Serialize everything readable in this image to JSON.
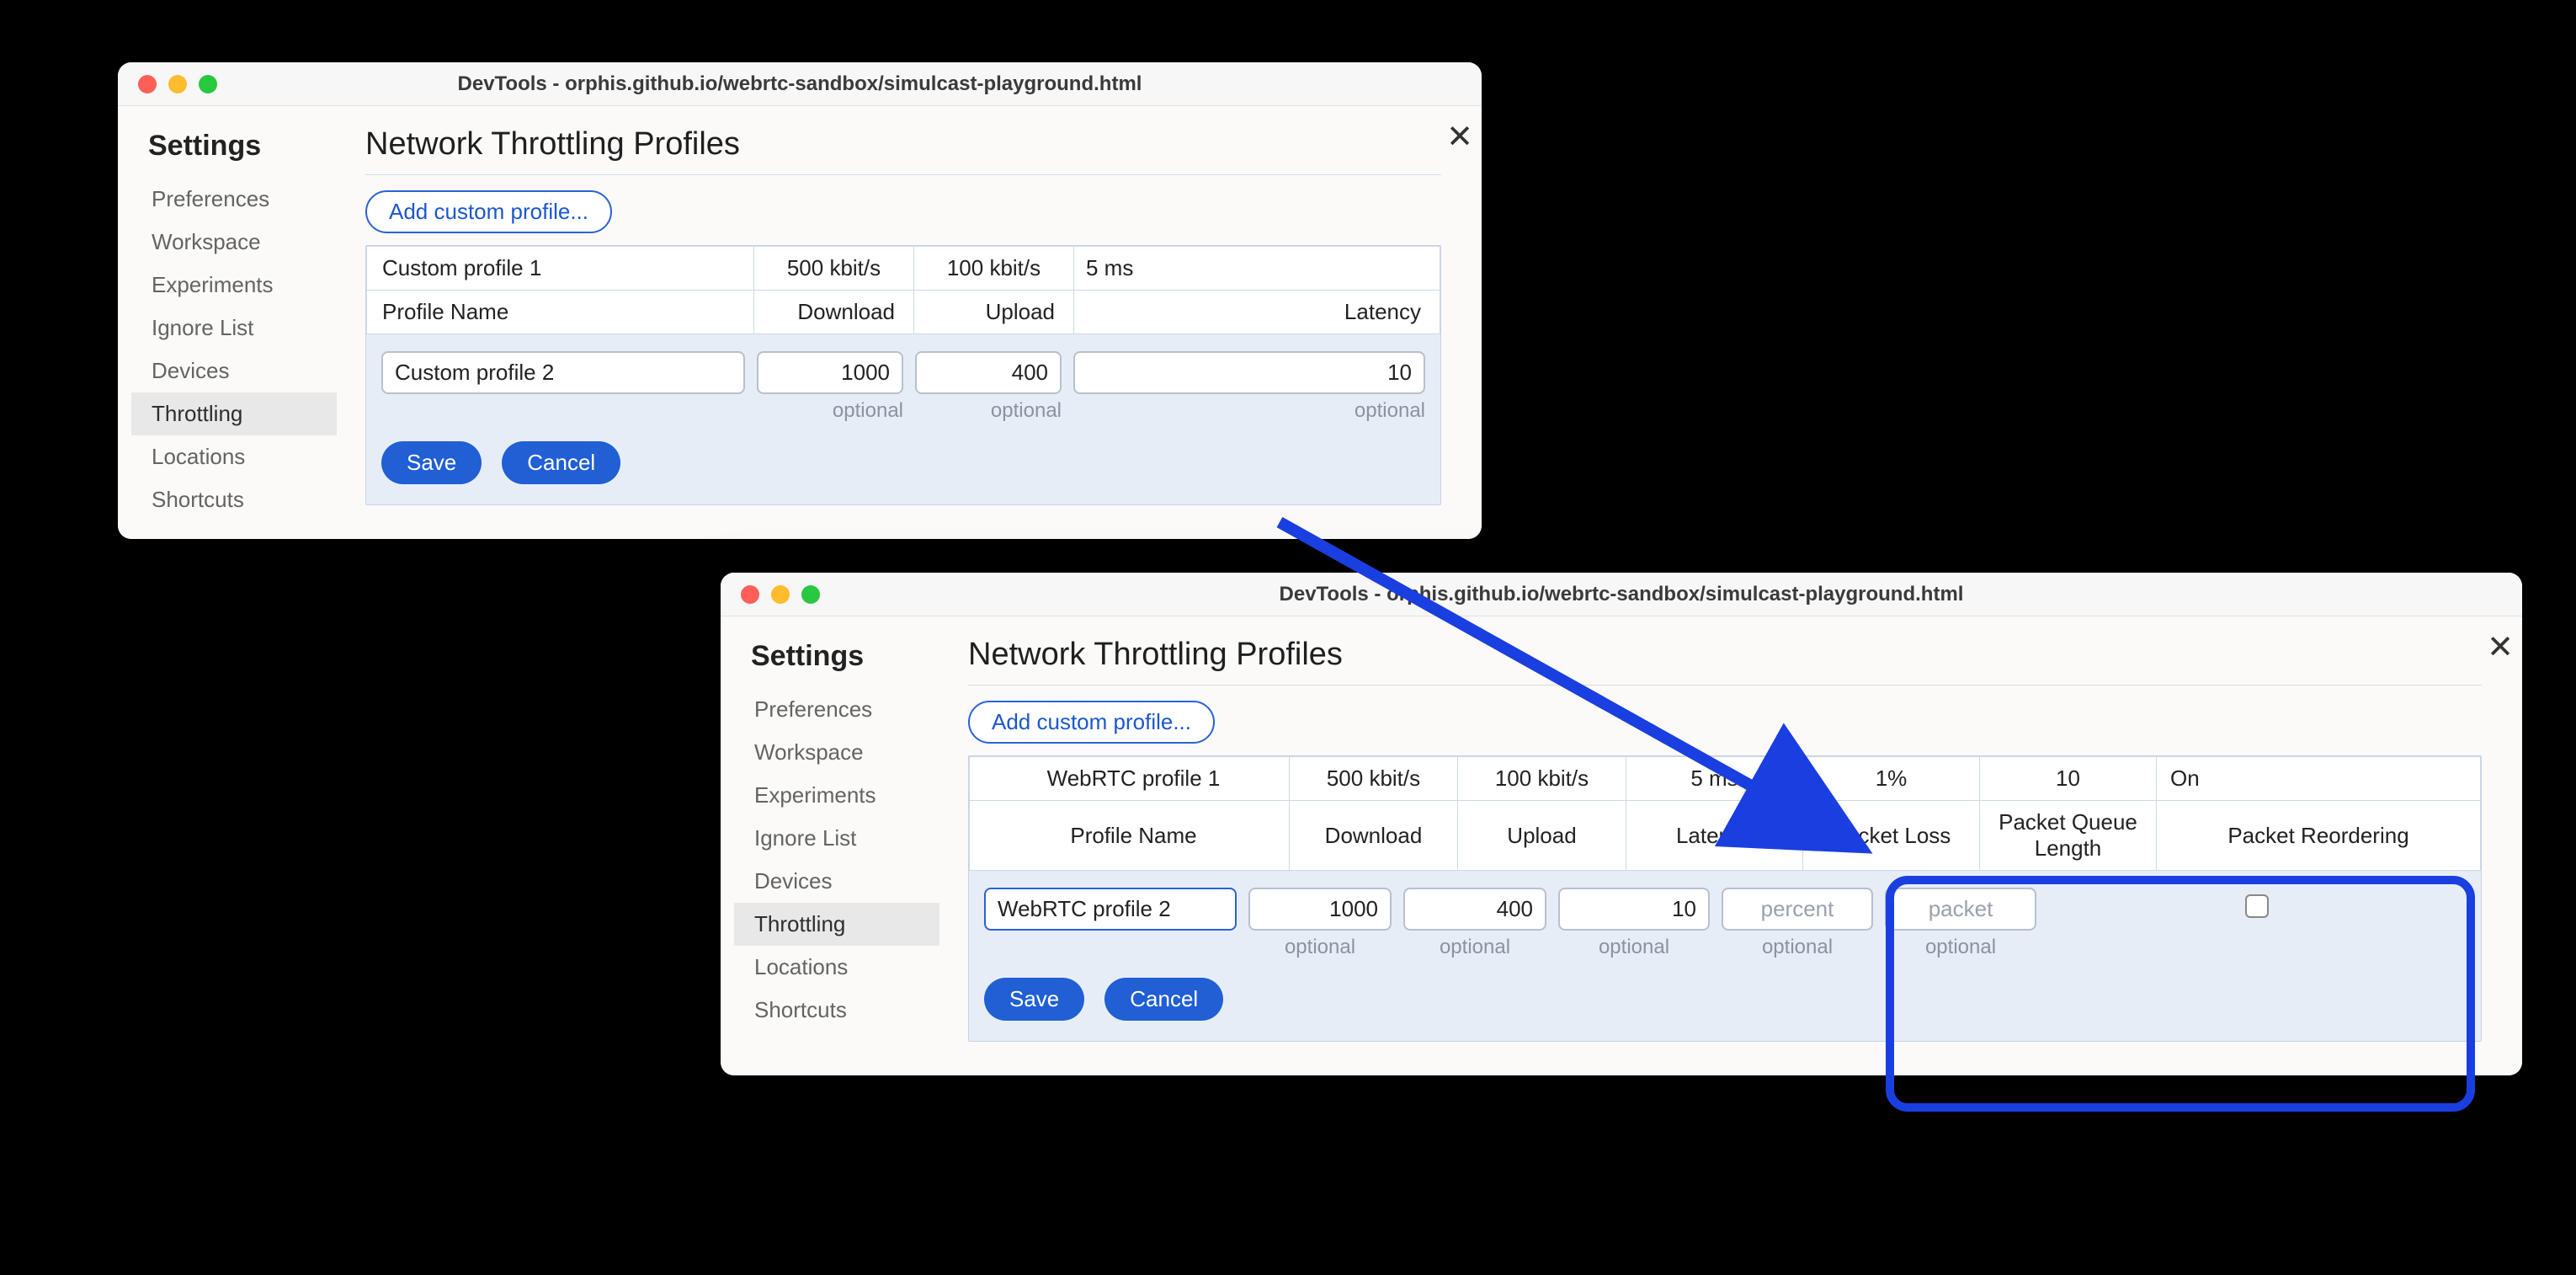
{
  "windowA": {
    "title": "DevTools - orphis.github.io/webrtc-sandbox/simulcast-playground.html",
    "settings_heading": "Settings",
    "sidebar": [
      "Preferences",
      "Workspace",
      "Experiments",
      "Ignore List",
      "Devices",
      "Throttling",
      "Locations",
      "Shortcuts"
    ],
    "active_sidebar_index": 5,
    "page_title": "Network Throttling Profiles",
    "add_button": "Add custom profile...",
    "columns": [
      "Profile Name",
      "Download",
      "Upload",
      "Latency"
    ],
    "existing_row": {
      "name": "Custom profile 1",
      "download": "500 kbit/s",
      "upload": "100 kbit/s",
      "latency": "5 ms"
    },
    "edit_row": {
      "name": "Custom profile 2",
      "download": "1000",
      "upload": "400",
      "latency": "10"
    },
    "hint": "optional",
    "save": "Save",
    "cancel": "Cancel"
  },
  "windowB": {
    "title": "DevTools - orphis.github.io/webrtc-sandbox/simulcast-playground.html",
    "settings_heading": "Settings",
    "sidebar": [
      "Preferences",
      "Workspace",
      "Experiments",
      "Ignore List",
      "Devices",
      "Throttling",
      "Locations",
      "Shortcuts"
    ],
    "active_sidebar_index": 5,
    "page_title": "Network Throttling Profiles",
    "add_button": "Add custom profile...",
    "columns": [
      "Profile Name",
      "Download",
      "Upload",
      "Latency",
      "Packet Loss",
      "Packet Queue Length",
      "Packet Reordering"
    ],
    "existing_row": {
      "name": "WebRTC profile 1",
      "download": "500 kbit/s",
      "upload": "100 kbit/s",
      "latency": "5 ms",
      "loss": "1%",
      "queue": "10",
      "reorder": "On"
    },
    "edit_row": {
      "name": "WebRTC profile 2",
      "download": "1000",
      "upload": "400",
      "latency": "10",
      "loss_placeholder": "percent",
      "queue_placeholder": "packet"
    },
    "hint": "optional",
    "save": "Save",
    "cancel": "Cancel"
  }
}
